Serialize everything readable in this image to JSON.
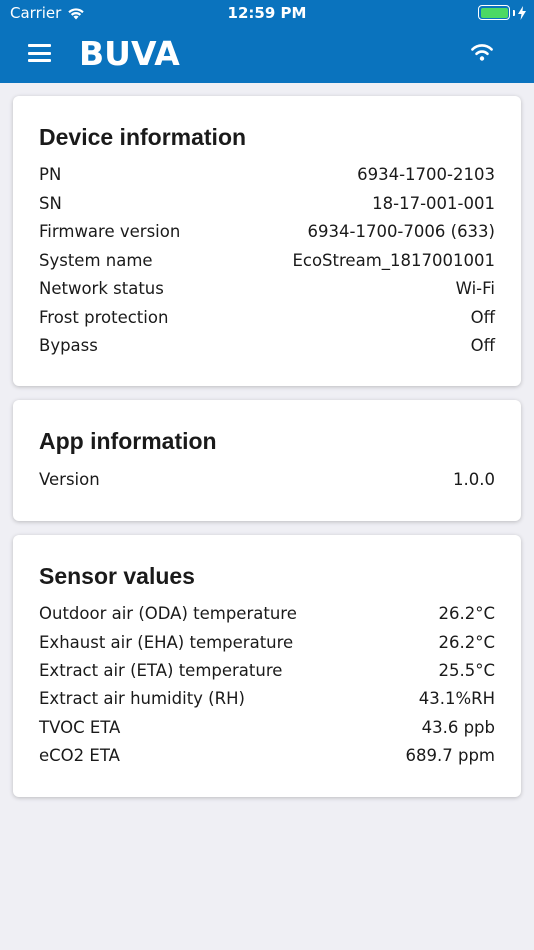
{
  "status_bar": {
    "carrier": "Carrier",
    "time": "12:59 PM",
    "battery_level": 1.0,
    "battery_color": "#4cd964"
  },
  "header": {
    "brand": "BUVA",
    "background": "#0a73be",
    "menu_icon": "hamburger-menu-icon",
    "wifi_icon": "wifi-icon"
  },
  "device_info": {
    "title": "Device information",
    "rows": [
      {
        "label": "PN",
        "value": "6934-1700-2103"
      },
      {
        "label": "SN",
        "value": "18-17-001-001"
      },
      {
        "label": "Firmware version",
        "value": "6934-1700-7006 (633)"
      },
      {
        "label": "System name",
        "value": "EcoStream_1817001001"
      },
      {
        "label": "Network status",
        "value": "Wi-Fi"
      },
      {
        "label": "Frost protection",
        "value": "Off"
      },
      {
        "label": "Bypass",
        "value": "Off"
      }
    ]
  },
  "app_info": {
    "title": "App information",
    "rows": [
      {
        "label": "Version",
        "value": "1.0.0"
      }
    ]
  },
  "sensor_values": {
    "title": "Sensor values",
    "rows": [
      {
        "label": "Outdoor air (ODA) temperature",
        "value": "26.2°C"
      },
      {
        "label": "Exhaust air (EHA) temperature",
        "value": "26.2°C"
      },
      {
        "label": "Extract air (ETA) temperature",
        "value": "25.5°C"
      },
      {
        "label": "Extract air humidity (RH)",
        "value": "43.1%RH"
      },
      {
        "label": "TVOC ETA",
        "value": "43.6 ppb"
      },
      {
        "label": "eCO2 ETA",
        "value": "689.7 ppm"
      }
    ]
  }
}
